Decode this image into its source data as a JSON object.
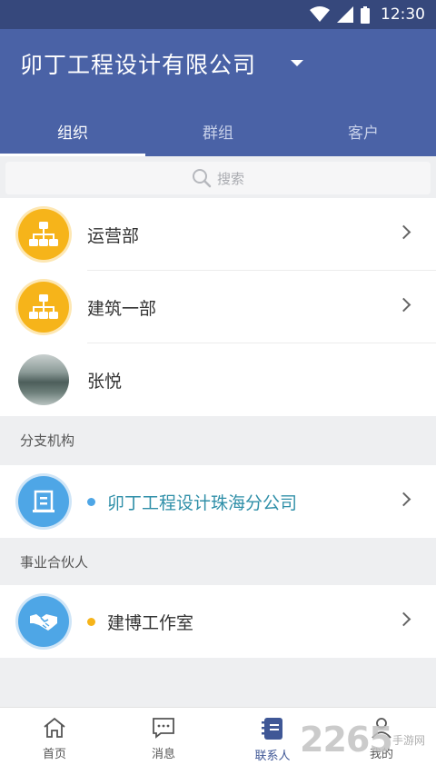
{
  "status_bar": {
    "time": "12:30"
  },
  "header": {
    "company": "卯丁工程设计有限公司"
  },
  "tabs": [
    {
      "label": "组织",
      "active": true
    },
    {
      "label": "群组",
      "active": false
    },
    {
      "label": "客户",
      "active": false
    }
  ],
  "search": {
    "placeholder": "搜索"
  },
  "org_list": [
    {
      "label": "运营部",
      "icon": "org-chart-icon"
    },
    {
      "label": "建筑一部",
      "icon": "org-chart-icon"
    },
    {
      "label": "张悦",
      "icon": "user-photo"
    }
  ],
  "branch_section": {
    "title": "分支机构",
    "items": [
      {
        "label": "卯丁工程设计珠海分公司",
        "dot_color": "#4ea6e6",
        "icon": "building-icon"
      }
    ]
  },
  "partner_section": {
    "title": "事业合伙人",
    "items": [
      {
        "label": "建博工作室",
        "dot_color": "#f6b41a",
        "icon": "handshake-icon"
      }
    ]
  },
  "bottom_nav": [
    {
      "label": "首页",
      "icon": "home-icon",
      "active": false
    },
    {
      "label": "消息",
      "icon": "message-icon",
      "active": false
    },
    {
      "label": "联系人",
      "icon": "contacts-icon",
      "active": true
    },
    {
      "label": "我的",
      "icon": "profile-icon",
      "active": false
    }
  ],
  "watermark": {
    "main": "2265",
    "sub": "手游网"
  },
  "colors": {
    "primary": "#4a62a6",
    "status_bar": "#36487c",
    "orange": "#f6b41a",
    "blue": "#4ea6e6",
    "teal_text": "#2f8fa8"
  }
}
